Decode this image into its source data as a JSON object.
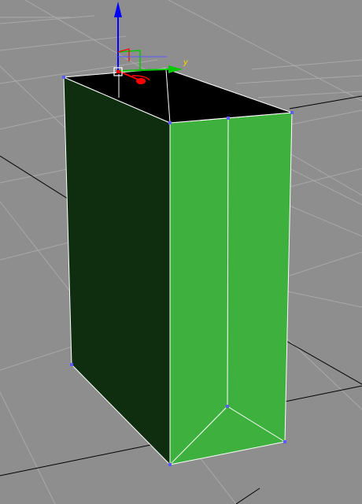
{
  "viewport": {
    "background_color": "#8e8e8e",
    "grid_color": "#adadad",
    "grid_major_color": "#000000"
  },
  "object": {
    "front_face_color": "#3eb03e",
    "side_face_color": "#0f2e10",
    "top_face_color": "#000000",
    "edge_color": "#ffffff",
    "vertex_color": "#5b5bff"
  },
  "gizmo": {
    "x_axis_color": "#ff0000",
    "y_axis_color": "#00c800",
    "z_axis_color": "#0000ff",
    "y_label": "y",
    "pivot_color": "#ffffff"
  }
}
